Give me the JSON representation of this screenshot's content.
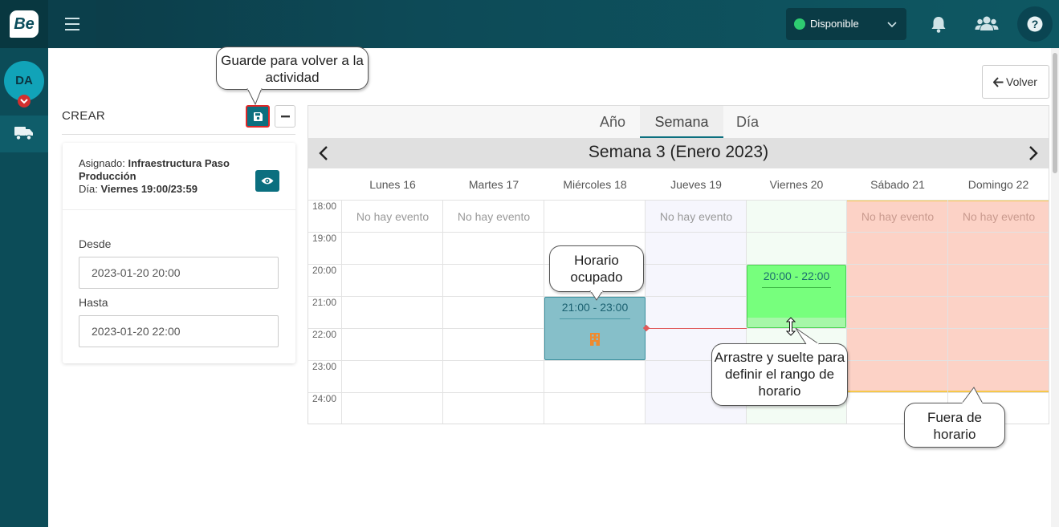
{
  "app": {
    "logo_text": "Be"
  },
  "topbar": {
    "status": {
      "label": "Disponible",
      "color": "#2ecc71"
    },
    "icons": [
      "menu-icon",
      "bell-icon",
      "users-icon",
      "help-icon"
    ]
  },
  "sidebar": {
    "avatar_initials": "DA",
    "items": [
      {
        "icon": "truck-icon"
      }
    ]
  },
  "panel": {
    "title": "CREAR",
    "assigned_label": "Asignado:",
    "assigned_value": "Infraestructura Paso Producción",
    "day_label": "Día:",
    "day_value": "Viernes 19:00/23:59",
    "from_label": "Desde",
    "from_value": "2023-01-20 20:00",
    "to_label": "Hasta",
    "to_value": "2023-01-20 22:00"
  },
  "volver": {
    "label": "Volver"
  },
  "calendar": {
    "tabs": [
      {
        "label": "Año",
        "active": false
      },
      {
        "label": "Semana",
        "active": true
      },
      {
        "label": "Día",
        "active": false
      }
    ],
    "week_title": "Semana 3 (Enero 2023)",
    "days": [
      "Lunes 16",
      "Martes 17",
      "Miércoles 18",
      "Jueves 19",
      "Viernes 20",
      "Sábado 21",
      "Domingo 22"
    ],
    "hours": [
      "18:00",
      "19:00",
      "20:00",
      "21:00",
      "22:00",
      "23:00",
      "24:00"
    ],
    "no_event_text": "No hay evento",
    "busy_event": {
      "time": "21:00 - 23:00",
      "day": "Miércoles 18"
    },
    "new_event": {
      "time": "20:00 - 22:00",
      "day": "Viernes 20"
    },
    "colors": {
      "busy": "#86bfc9",
      "new": "#77ff7d",
      "out_of_schedule": "#fcd2c6",
      "accent": "#0b6f7f"
    }
  },
  "callouts": {
    "save": "Guarde para volver a la actividad",
    "busy": "Horario ocupado",
    "drag": "Arrastre y suelte para definir el rango de horario",
    "out": "Fuera de horario"
  }
}
